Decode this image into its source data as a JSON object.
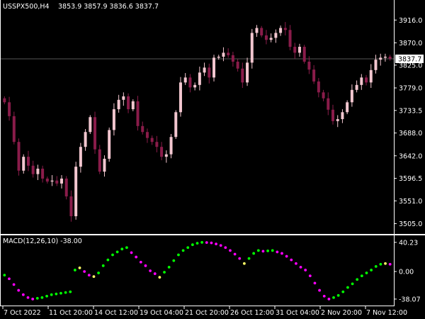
{
  "header": {
    "symbol": "USSPX500,H4",
    "ohlc": "3853.9 3857.9 3836.6 3837.7"
  },
  "main_axis": {
    "ticks": [
      "3916.0",
      "3870.0",
      "3825.0",
      "3779.0",
      "3733.5",
      "3688.0",
      "3642.0",
      "3596.5",
      "3551.0",
      "3505.0"
    ],
    "tick_values": [
      3916.0,
      3870.0,
      3825.0,
      3779.0,
      3733.5,
      3688.0,
      3642.0,
      3596.5,
      3551.0,
      3505.0
    ],
    "ylim": [
      3490,
      3945
    ]
  },
  "current_price": {
    "label": "3837.7",
    "value": 3837.7
  },
  "indicator": {
    "label": "MACD(12,26,10) -38.00",
    "ticks": [
      "40.23",
      "0.00",
      "-38.07"
    ],
    "tick_values": [
      40.23,
      0.0,
      -38.07
    ],
    "ylim": [
      -46,
      46
    ]
  },
  "time_axis": {
    "labels": [
      "7 Oct 2022",
      "11 Oct 20:00",
      "14 Oct 12:00",
      "19 Oct 04:00",
      "21 Oct 20:00",
      "26 Oct 12:00",
      "31 Oct 04:00",
      "2 Nov 20:00",
      "7 Nov 12:00"
    ]
  },
  "colors": {
    "bull_candle": "#f2c6cf",
    "bear_candle": "#8a1c4a",
    "macd_up": "#00ff00",
    "macd_down": "#ff00ff",
    "macd_neutral": "#ffff66",
    "grid": "#444444"
  },
  "chart_data": {
    "type": "candlestick",
    "series": [
      {
        "name": "USSPX500,H4",
        "close": [
          3750,
          3722,
          3670,
          3612,
          3640,
          3622,
          3605,
          3616,
          3596,
          3590,
          3592,
          3586,
          3596,
          3560,
          3520,
          3620,
          3660,
          3690,
          3720,
          3655,
          3610,
          3636,
          3694,
          3736,
          3755,
          3762,
          3736,
          3752,
          3702,
          3690,
          3678,
          3670,
          3660,
          3640,
          3645,
          3680,
          3730,
          3790,
          3800,
          3780,
          3785,
          3810,
          3820,
          3800,
          3840,
          3842,
          3850,
          3845,
          3832,
          3818,
          3790,
          3830,
          3890,
          3900,
          3885,
          3876,
          3880,
          3890,
          3900,
          3896,
          3862,
          3850,
          3862,
          3832,
          3816,
          3792,
          3770,
          3758,
          3735,
          3712,
          3716,
          3730,
          3750,
          3775,
          3785,
          3800,
          3790,
          3815,
          3836,
          3840,
          3842,
          3838
        ]
      }
    ],
    "macd": [
      -5,
      -10,
      -18,
      -26,
      -32,
      -36,
      -38,
      -37,
      -36,
      -34,
      -32,
      -31,
      -30,
      -29,
      -28,
      2,
      5,
      0,
      -5,
      -7,
      -2,
      8,
      16,
      23,
      27,
      31,
      33,
      26,
      20,
      13,
      8,
      1,
      -3,
      -8,
      -1,
      6,
      15,
      23,
      29,
      33,
      37,
      39,
      40.2,
      40,
      39.5,
      38,
      36,
      33,
      29,
      24,
      18,
      11,
      18,
      25,
      29,
      28,
      28.5,
      29,
      27,
      25,
      21,
      16,
      11,
      6,
      2,
      -6,
      -16,
      -26,
      -34,
      -38,
      -36,
      -33,
      -28,
      -22,
      -17,
      -11,
      -6,
      -2,
      2,
      7,
      10,
      11,
      10
    ]
  }
}
